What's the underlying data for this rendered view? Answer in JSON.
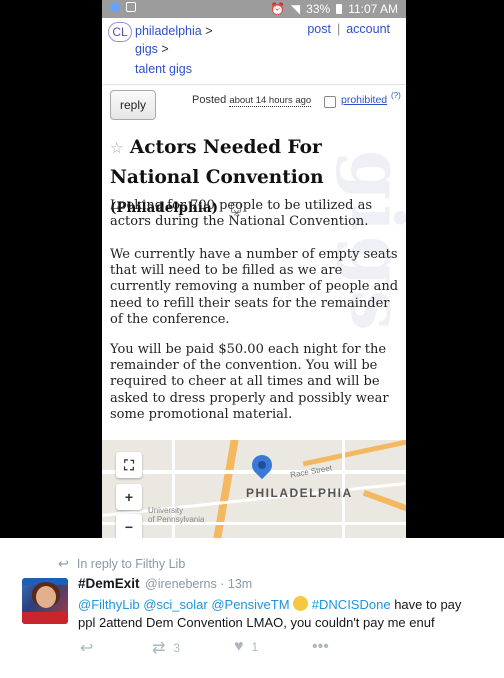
{
  "status_bar": {
    "battery": "33%",
    "time": "11:07 AM"
  },
  "nav": {
    "logo": "CL",
    "breadcrumbs": [
      {
        "label": "philadelphia",
        "sep": ">"
      },
      {
        "label": "gigs",
        "sep": ">"
      },
      {
        "label": "talent gigs",
        "sep": ""
      }
    ],
    "links": [
      "post",
      "account"
    ]
  },
  "posting": {
    "reply_label": "reply",
    "posted_label": "Posted",
    "posted_ago": "about 14 hours ago",
    "prohibited_label": "prohibited",
    "prohibited_help": "(?)",
    "title": "Actors Needed For National Convention",
    "location": "(Philadelphia)",
    "paragraphs": [
      "Looking for 700 people to be utilized as actors during the National Convention.",
      "We currently have a number of empty seats that will need to be filled as we are currently removing a number of people and need to refill their seats for the remainder of the conference.",
      "You will be paid $50.00 each night for the remainder of the convention. You will be required to cheer at all times and will be asked to dress properly and possibly wear some promotional material."
    ],
    "watermark": "gigs"
  },
  "map": {
    "city_label": "PHILADELPHIA",
    "street_label": "Race Street",
    "university_label_1": "University",
    "university_label_2": "of Pennsylvania",
    "fullscreen_icon": "fullscreen-icon",
    "plus": "+",
    "minus": "−"
  },
  "tweet": {
    "reply_context": "In reply to Filthy Lib",
    "name": "#DemExit",
    "handle": "@ireneberns",
    "time": "13m",
    "text_parts": {
      "mentions": "@FilthyLib @sci_solar @PensiveTM",
      "hashtag": "#DNCISDone",
      "rest_line1": "have to pay",
      "line2": "ppl 2attend Dem Convention LMAO, you couldn't pay me enuf"
    },
    "retweets": "3",
    "likes": "1",
    "more": "•••"
  },
  "colors": {
    "link": "#2b52c8",
    "twitter_link": "#1b95e0",
    "twitter_gray": "#8899a6"
  }
}
